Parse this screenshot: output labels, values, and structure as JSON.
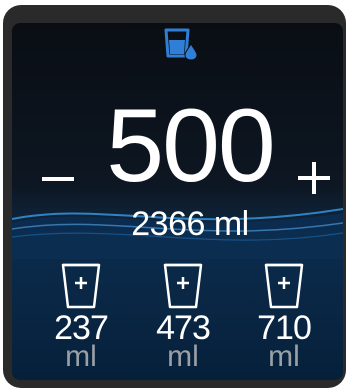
{
  "main": {
    "current_amount": "500",
    "total_intake": "2366 ml"
  },
  "presets": [
    {
      "amount": "237",
      "unit": "ml"
    },
    {
      "amount": "473",
      "unit": "ml"
    },
    {
      "amount": "710",
      "unit": "ml"
    }
  ],
  "colors": {
    "accent": "#2f7fd6",
    "text": "#ffffff",
    "unit_text": "#9aa0a6",
    "bezel": "#2a2a2a"
  },
  "icons": {
    "header": "water-glass-drop-icon",
    "minus": "minus-icon",
    "plus": "plus-icon",
    "preset_cup": "cup-add-icon"
  }
}
